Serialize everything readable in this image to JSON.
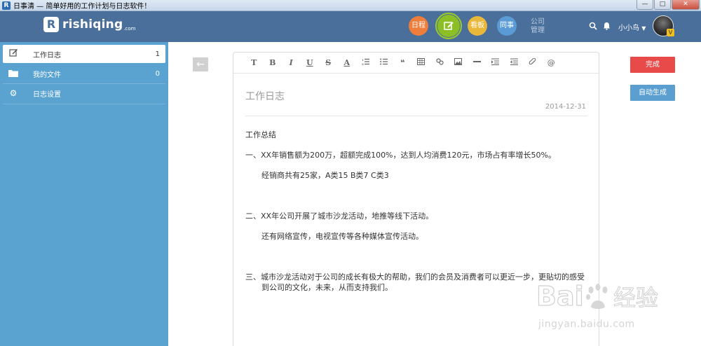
{
  "window": {
    "title": "日事清 — 简单好用的工作计划与日志软件！",
    "minimize_label": "—",
    "maximize_label": "□",
    "close_label": "✕"
  },
  "header": {
    "logo_text": "rishiqing",
    "logo_suffix": ".com",
    "nav": {
      "schedule": "日程",
      "board": "看板",
      "colleague": "同事",
      "company": "公司管理"
    },
    "user_name": "小小鸟",
    "avatar_badge": "V"
  },
  "sidebar": {
    "items": [
      {
        "label": "工作日志",
        "count": "1",
        "icon": "edit-icon"
      },
      {
        "label": "我的文件",
        "count": "0",
        "icon": "folder-icon"
      },
      {
        "label": "日志设置",
        "count": "",
        "icon": "gear-icon"
      }
    ]
  },
  "editor": {
    "toolbar": [
      "T",
      "B",
      "I",
      "U",
      "S",
      "A",
      "ordered-list",
      "unordered-list",
      "quote",
      "table",
      "link",
      "image",
      "hr",
      "indent",
      "outdent",
      "attachment",
      "mention"
    ],
    "title": "工作日志",
    "date": "2014-12-31",
    "body": {
      "heading": "工作总结",
      "p1": "一、XX年销售额为200万，超额完成100%，达到人均消费120元，市场占有率增长50%。",
      "p1_sub": "经销商共有25家，A类15  B类7 C类3",
      "p2": "二、XX年公司开展了城市沙龙活动，地推等线下活动。",
      "p2_sub": "还有网络宣传，电视宣传等各种媒体宣传活动。",
      "p3": "三、城市沙龙活动对于公司的成长有极大的帮助，我们的会员及消费者可以更近一步，更贴切的感受到公司的文化，未来，从而支持我们。"
    }
  },
  "actions": {
    "done": "完成",
    "auto_generate": "自动生成"
  },
  "watermark": {
    "logo": "Bai经验",
    "url": "jingyan.baidu.com"
  },
  "colors": {
    "header_bg": "#4a6f9a",
    "sidebar_bg": "#5aa3d0",
    "done_btn": "#e84a4a",
    "auto_btn": "#5b9fd1",
    "schedule": "#ef7d3c",
    "edit": "#8cbf26",
    "board": "#e9b73a",
    "colleague": "#5b9bd5"
  }
}
